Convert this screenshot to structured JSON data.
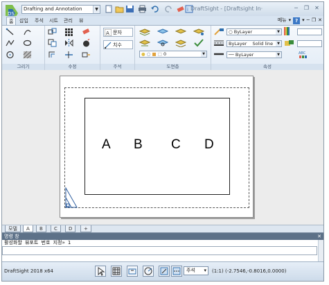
{
  "titlebar": {
    "workspace": "Drafting and Annotation",
    "title": "DraftSight - [Draftsight In·",
    "menu_label": "메뉴",
    "help_label": "?"
  },
  "ribbon_tabs": [
    "홈",
    "삽입",
    "주석",
    "시트",
    "관리",
    "뷰"
  ],
  "ribbon": {
    "panels": {
      "draw": "그리기",
      "modify": "수정",
      "annotate": "주석",
      "layer": "도면층",
      "properties": "속성"
    },
    "annotate_text_label": "문자",
    "annotate_dim_label": "치수",
    "layer_combo": "0",
    "color_combo": "ByLayer",
    "linestyle_combo_1": "ByLayer",
    "linestyle_combo_2": "Solid line",
    "lineweight_combo": "ByLayer"
  },
  "drawing": {
    "letters": [
      "A",
      "B",
      "C",
      "D"
    ]
  },
  "layout_tabs": [
    "모델",
    "A",
    "B",
    "C",
    "D",
    "+"
  ],
  "command_window": {
    "title": "명령 창",
    "line": "활성화할 뷰포트 번호 지정» 1"
  },
  "status": {
    "app": "DraftSight 2018 x64",
    "annotation_combo": "주석",
    "scale": "(1:1)",
    "coordinates": "(-2.7546,-0.8016,0.0000)"
  },
  "colors": {
    "accent": "#3b78c6",
    "ribbon_bg": "#e3ecf6",
    "command_header": "#5d7188"
  }
}
